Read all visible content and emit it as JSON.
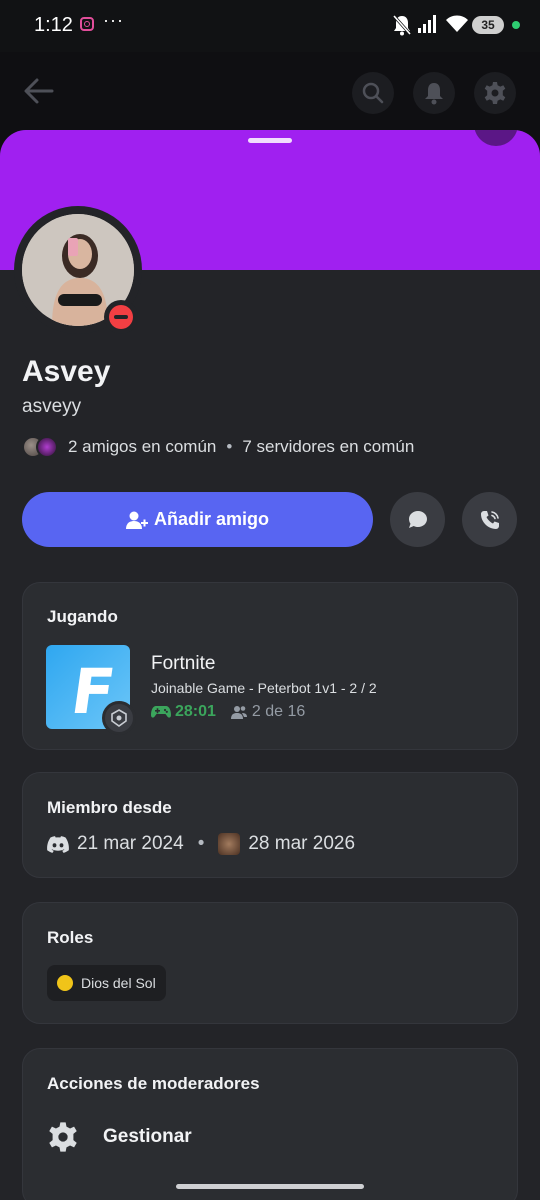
{
  "status_bar": {
    "time": "1:12",
    "more": "···",
    "battery": "35"
  },
  "profile": {
    "display_name": "Asvey",
    "username": "asveyy",
    "mutual_friends": "2 amigos en común",
    "separator": "•",
    "mutual_servers": "7 servidores en común",
    "status": "dnd"
  },
  "actions": {
    "add_friend_label": "Añadir amigo"
  },
  "playing": {
    "title": "Jugando",
    "game_name": "Fortnite",
    "details": "Joinable Game - Peterbot 1v1 - 2 / 2",
    "elapsed": "28:01",
    "party": "2 de 16"
  },
  "member_since": {
    "title": "Miembro desde",
    "discord_date": "21 mar 2024",
    "separator": "•",
    "server_date": "28 mar 2026"
  },
  "roles": {
    "title": "Roles",
    "items": [
      {
        "name": "Dios del Sol",
        "color": "#f0c419"
      }
    ]
  },
  "moderation": {
    "title": "Acciones de moderadores",
    "manage_label": "Gestionar"
  },
  "colors": {
    "banner": "#a020f0",
    "accent": "#5865f2",
    "dnd": "#f23f43",
    "elapsed": "#3ba55c"
  }
}
